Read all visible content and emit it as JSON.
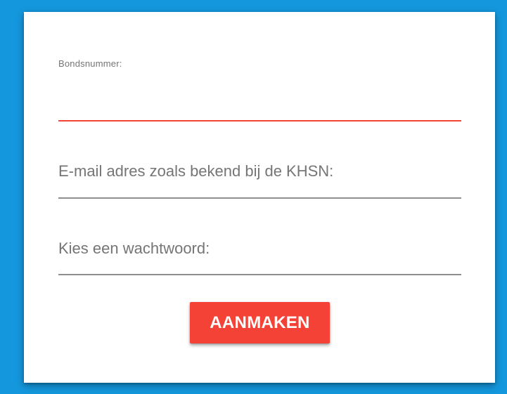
{
  "form": {
    "member_number": {
      "label": "Bondsnummer:",
      "value": ""
    },
    "email": {
      "label": "E-mail adres zoals bekend bij de KHSN:",
      "value": ""
    },
    "password": {
      "label": "Kies een wachtwoord:",
      "value": ""
    },
    "submit_label": "AANMAKEN"
  },
  "colors": {
    "background": "#1497dc",
    "card": "#ffffff",
    "accent": "#f44336",
    "underline": "#8e8e8e",
    "label": "#757575"
  }
}
